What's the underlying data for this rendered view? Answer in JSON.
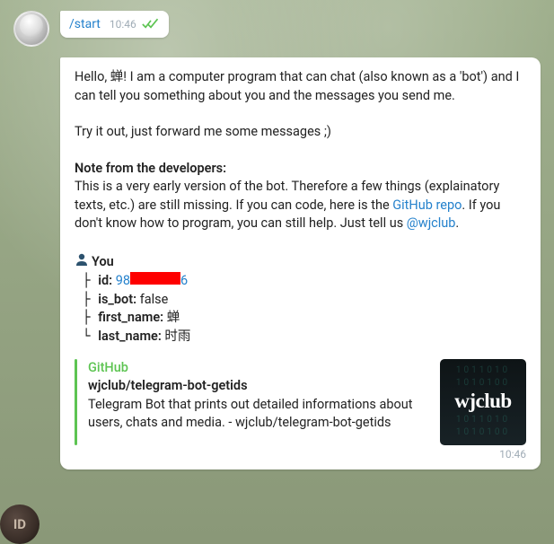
{
  "outgoing": {
    "command": "/start",
    "time": "10:46"
  },
  "bot_message": {
    "greeting": "Hello, 蝉! I am a computer program that can chat (also known as a 'bot') and I can tell you something about you and the messages you send me.",
    "tryit": "Try it out, just forward me some messages ;)",
    "note_heading": "Note from the developers:",
    "note_text_1": "This is a very early version of the bot. Therefore a few things (explainatory texts, etc.) are still missing. If you can code, here is the ",
    "github_link": "GitHub repo",
    "note_text_2": ". If you don't know how to program, you can still help. Just tell us ",
    "wjclub_link": "@wjclub",
    "note_text_3": "."
  },
  "user_info": {
    "heading": "You",
    "id_label": "id:",
    "id_prefix": "98",
    "id_suffix": "6",
    "is_bot_label": "is_bot:",
    "is_bot_value": "false",
    "first_name_label": "first_name:",
    "first_name_value": "蝉",
    "last_name_label": "last_name:",
    "last_name_value": "时雨"
  },
  "preview": {
    "site": "GitHub",
    "title": "wjclub/telegram-bot-getids",
    "description": "Telegram Bot that prints out detailed informations about users, chats and media. - wjclub/telegram-bot-getids",
    "thumb_text": "wjclub"
  },
  "bot_time": "10:46",
  "corner_badge": "ID"
}
